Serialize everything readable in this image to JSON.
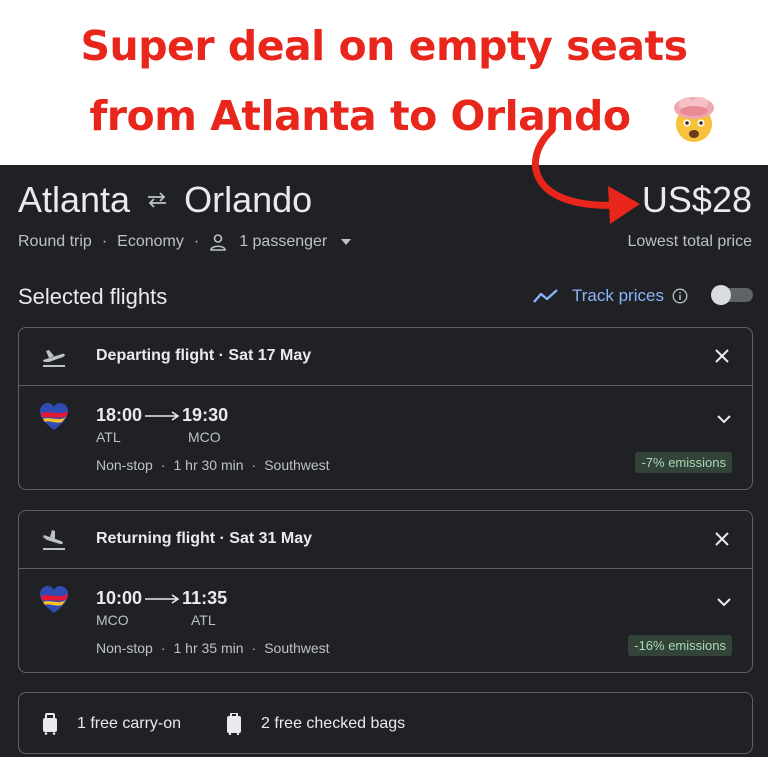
{
  "headline": {
    "line1": "Super deal on empty seats",
    "line2": "from Atlanta to Orlando",
    "emoji_icon": "exploding-head-icon",
    "color": "#e8261c"
  },
  "summary": {
    "origin": "Atlanta",
    "destination": "Orlando",
    "price": "US$28",
    "price_caption": "Lowest total price",
    "trip_type": "Round trip",
    "cabin": "Economy",
    "passengers": "1 passenger"
  },
  "selected": {
    "title": "Selected flights",
    "track_label": "Track prices"
  },
  "flights": [
    {
      "heading": "Departing flight · Sat 17 May",
      "depart_time": "18:00",
      "arrive_time": "19:30",
      "from": "ATL",
      "to": "MCO",
      "stops": "Non-stop",
      "duration": "1 hr 30 min",
      "airline": "Southwest",
      "emissions": "-7% emissions"
    },
    {
      "heading": "Returning flight · Sat 31 May",
      "depart_time": "10:00",
      "arrive_time": "11:35",
      "from": "MCO",
      "to": "ATL",
      "stops": "Non-stop",
      "duration": "1 hr 35 min",
      "airline": "Southwest",
      "emissions": "-16% emissions"
    }
  ],
  "baggage": {
    "carry_on": "1 free carry-on",
    "checked": "2 free checked bags"
  },
  "colors": {
    "panel_bg": "#202124",
    "accent_blue": "#8ab4f8",
    "emissions_bg": "#34433a",
    "emissions_text": "#a8dab5"
  }
}
